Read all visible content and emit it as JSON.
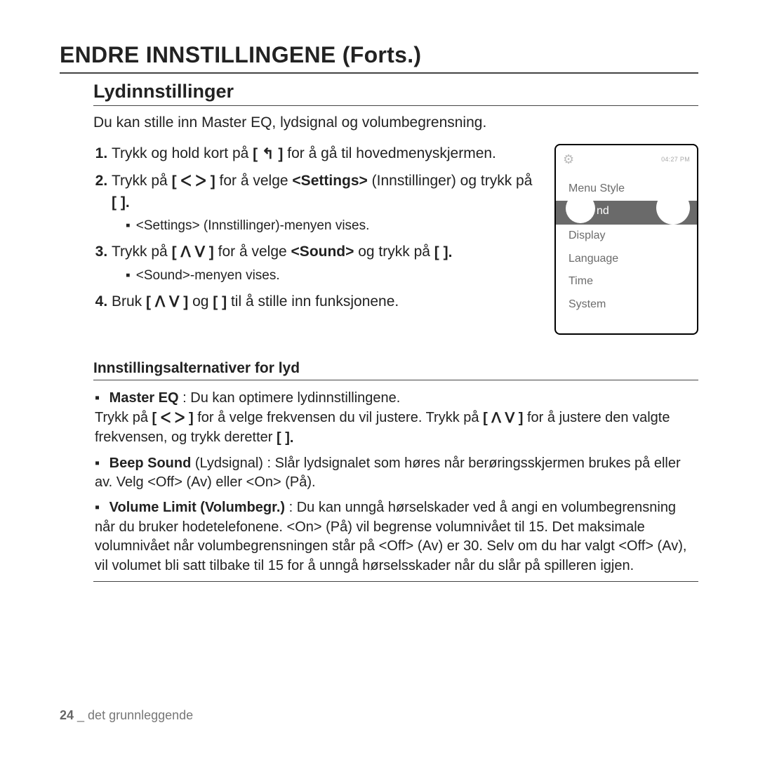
{
  "page_title": "ENDRE INNSTILLINGENE (Forts.)",
  "section": {
    "title": "Lydinnstillinger",
    "intro": "Du kan stille inn Master EQ, lydsignal og volumbegrensning."
  },
  "steps": {
    "s1_a": "Trykk og hold kort på ",
    "s1_icon": "[ ↰ ]",
    "s1_b": " for å gå til hovedmenyskjermen.",
    "s2_a": "Trykk på ",
    "s2_icon1": "[ ᐸ  ᐳ ]",
    "s2_b": " for å velge ",
    "s2_bold": "<Settings>",
    "s2_c": " (Innstillinger) og trykk på ",
    "s2_icon2": "[     ].",
    "s2_sub": "<Settings> (Innstillinger)-menyen vises.",
    "s3_a": "Trykk på ",
    "s3_icon1": "[ ᐱ  ᐯ ]",
    "s3_b": " for å velge ",
    "s3_bold": "<Sound>",
    "s3_c": " og trykk på ",
    "s3_icon2": "[     ].",
    "s3_sub": "<Sound>-menyen vises.",
    "s4_a": "Bruk ",
    "s4_icon1": "[ ᐱ  ᐯ ]",
    "s4_b": " og ",
    "s4_icon2": "[     ]",
    "s4_c": " til å stille inn funksjonene."
  },
  "device": {
    "time": "04:27 PM",
    "items": [
      "Menu Style",
      "nd",
      "Display",
      "Language",
      "Time",
      "System"
    ],
    "selected_fragment": "nd"
  },
  "options": {
    "title": "Innstillingsalternativer for lyd",
    "o1_bold": "Master EQ",
    "o1_a": " : Du kan optimere lydinnstillingene.",
    "o1_line2_a": "Trykk på ",
    "o1_line2_icon1": "[ ᐸ   ᐳ ]",
    "o1_line2_b": " for å velge frekvensen du vil justere. Trykk på ",
    "o1_line2_icon2": "[ ᐱ  ᐯ ]",
    "o1_line2_c": " for å justere den valgte frekvensen, og trykk deretter ",
    "o1_line2_icon3": "[      ].",
    "o2_bold": "Beep Sound",
    "o2_a": " (Lydsignal) : Slår lydsignalet som høres når berøringsskjermen brukes på eller av. Velg <Off> (Av) eller <On> (På).",
    "o3_bold": "Volume Limit (Volumbegr.)",
    "o3_a": " : Du kan unngå hørselskader ved å angi en volumbegrensning når du bruker hodetelefonene. <On> (På) vil begrense volumnivået til 15. Det maksimale volumnivået når volumbegrensningen står på <Off> (Av) er 30. Selv om du har valgt <Off> (Av), vil volumet bli satt tilbake til 15 for å unngå hørselsskader når du slår på spilleren igjen."
  },
  "footer": {
    "page_num": "24",
    "sep": " _ ",
    "section": "det grunnleggende"
  }
}
